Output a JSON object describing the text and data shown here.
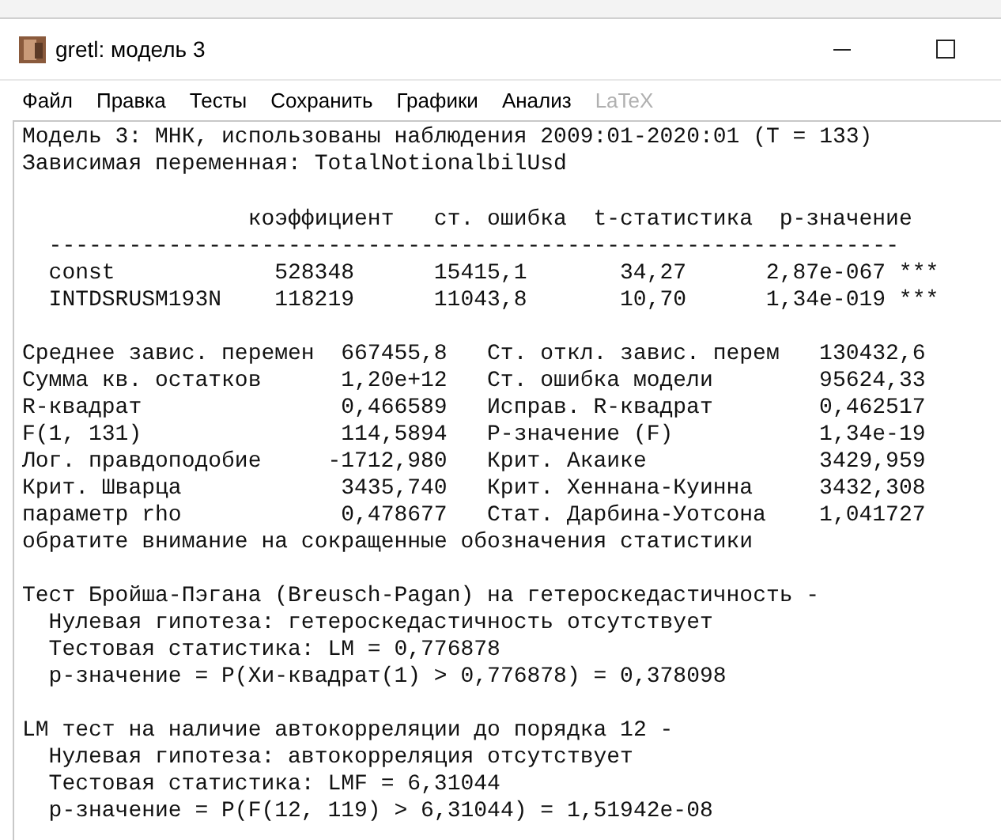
{
  "window": {
    "title": "gretl: модель 3"
  },
  "menu": [
    {
      "label": "Файл",
      "disabled": false
    },
    {
      "label": "Правка",
      "disabled": false
    },
    {
      "label": "Тесты",
      "disabled": false
    },
    {
      "label": "Сохранить",
      "disabled": false
    },
    {
      "label": "Графики",
      "disabled": false
    },
    {
      "label": "Анализ",
      "disabled": false
    },
    {
      "label": "LaTeX",
      "disabled": true
    }
  ],
  "output": {
    "header": [
      "Модель 3: МНК, использованы наблюдения 2009:01-2020:01 (T = 133)",
      "Зависимая переменная: TotalNotionalbilUsd"
    ],
    "coef_table": {
      "columns": [
        "коэффициент",
        "ст. ошибка",
        "t-статистика",
        "р-значение"
      ],
      "rule": "----------------------------------------------------------------",
      "rows": [
        {
          "name": "const",
          "values": [
            "528348",
            "15415,1",
            "34,27",
            "2,87e-067"
          ],
          "stars": "***"
        },
        {
          "name": "INTDSRUSM193N",
          "values": [
            "118219",
            "11043,8",
            "10,70",
            "1,34e-019"
          ],
          "stars": "***"
        }
      ]
    },
    "stats": [
      [
        "Среднее завис. перемен",
        "667455,8",
        "Ст. откл. завис. перем",
        "130432,6"
      ],
      [
        "Сумма кв. остатков",
        "1,20e+12",
        "Ст. ошибка модели",
        "95624,33"
      ],
      [
        "R-квадрат",
        "0,466589",
        "Исправ. R-квадрат",
        "0,462517"
      ],
      [
        "F(1, 131)",
        "114,5894",
        "Р-значение (F)",
        "1,34e-19"
      ],
      [
        "Лог. правдоподобие",
        "-1712,980",
        "Крит. Акаике",
        "3429,959"
      ],
      [
        "Крит. Шварца",
        "3435,740",
        "Крит. Хеннана-Куинна",
        "3432,308"
      ],
      [
        "параметр rho",
        "0,478677",
        "Стат. Дарбина-Уотсона",
        "1,041727"
      ]
    ],
    "note": "обратите внимание на сокращенные обозначения статистики",
    "tests": [
      {
        "title": "Тест Бройша-Пэгана (Breusch-Pagan) на гетероскедастичность -",
        "lines": [
          "Нулевая гипотеза: гетероскедастичность отсутствует",
          "Тестовая статистика: LM = 0,776878",
          "р-значение = P(Хи-квадрат(1) > 0,776878) = 0,378098"
        ]
      },
      {
        "title": "LM тест на наличие автокорреляции до порядка 12 -",
        "lines": [
          "Нулевая гипотеза: автокорреляция отсутствует",
          "Тестовая статистика: LMF = 6,31044",
          "р-значение = P(F(12, 119) > 6,31044) = 1,51942e-08"
        ]
      }
    ]
  }
}
